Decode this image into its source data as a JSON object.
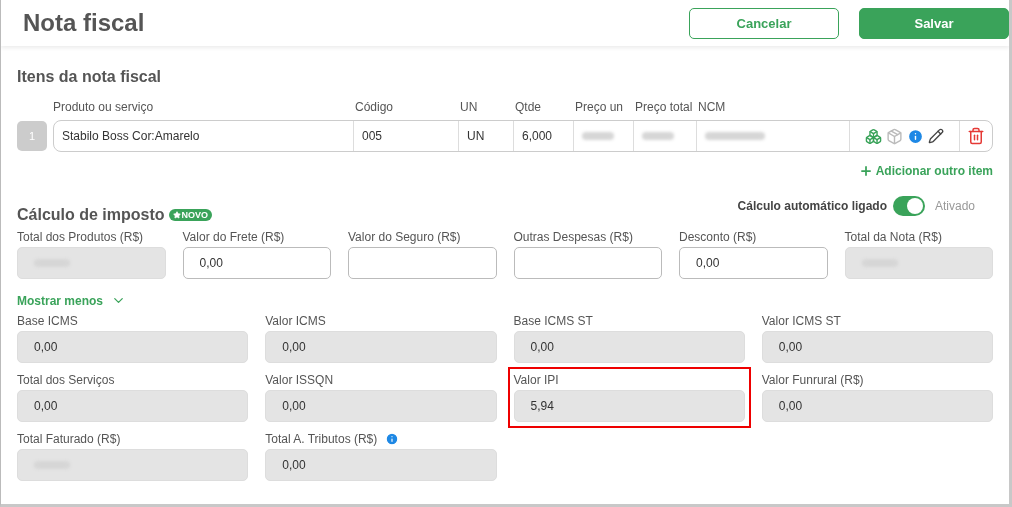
{
  "header": {
    "title": "Nota fiscal",
    "buttons": [
      {
        "label": "Cancelar",
        "kind": "secondary"
      },
      {
        "label": "Salvar",
        "kind": "primary"
      }
    ]
  },
  "items": {
    "title": "Itens da nota fiscal",
    "columns": [
      "Produto ou serviço",
      "Código",
      "UN",
      "Qtde",
      "Preço un",
      "Preço total",
      "NCM"
    ],
    "rows": [
      {
        "number": "1",
        "cells": [
          {
            "value": "Stabilo Boss Cor:Amarelo"
          },
          {
            "value": "005"
          },
          {
            "value": "UN"
          },
          {
            "value": "6,000"
          },
          {
            "redacted": true
          },
          {
            "redacted": true
          },
          {
            "redacted": true
          }
        ]
      }
    ],
    "add_label": "Adicionar outro item"
  },
  "tax": {
    "title": "Cálculo de imposto",
    "badge": "NOVO",
    "auto_label": "Cálculo automático ligado",
    "auto_on": true,
    "auto_state": "Ativado",
    "main_fields": [
      {
        "label": "Total dos Produtos (R$)",
        "disabled": true,
        "redacted": true
      },
      {
        "label": "Valor do Frete (R$)",
        "value": "0,00",
        "disabled": false
      },
      {
        "label": "Valor do Seguro (R$)",
        "disabled": false
      },
      {
        "label": "Outras Despesas (R$)",
        "disabled": false
      },
      {
        "label": "Desconto (R$)",
        "value": "0,00",
        "disabled": false
      },
      {
        "label": "Total da Nota (R$)",
        "disabled": true,
        "redacted": true
      }
    ],
    "toggle_label": "Mostrar menos",
    "expanded": true,
    "more_fields": [
      {
        "label": "Base ICMS",
        "value": "0,00"
      },
      {
        "label": "Valor ICMS",
        "value": "0,00"
      },
      {
        "label": "Base ICMS ST",
        "value": "0,00"
      },
      {
        "label": "Valor ICMS ST",
        "value": "0,00"
      },
      {
        "label": "Total dos Serviços",
        "value": "0,00"
      },
      {
        "label": "Valor ISSQN",
        "value": "0,00"
      },
      {
        "label": "Valor IPI",
        "value": "5,94",
        "highlighted": true
      },
      {
        "label": "Valor Funrural (R$)",
        "value": "0,00"
      },
      {
        "label": "Total Faturado (R$)",
        "redacted": true
      },
      {
        "label": "Total A. Tributos (R$)",
        "value": "0,00",
        "info": true
      }
    ]
  }
}
